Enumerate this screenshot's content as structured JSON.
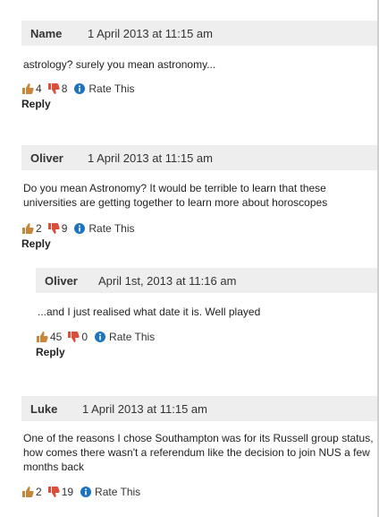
{
  "comments": [
    {
      "author": "Name",
      "date": "1 April 2013 at 11:15 am",
      "text": "astrology? surely you mean astronomy...",
      "likes": "4",
      "dislikes": "8",
      "rate_label": "Rate This",
      "reply_label": "Reply"
    },
    {
      "author": "Oliver",
      "date": "1 April 2013 at 11:15 am",
      "text": "Do you mean Astronomy? It would be terrible to learn that these universities are getting together to learn more about horoscopes",
      "likes": "2",
      "dislikes": "9",
      "rate_label": "Rate This",
      "reply_label": "Reply"
    },
    {
      "author": "Oliver",
      "date": "April 1st, 2013 at 11:16 am",
      "text": "...and I just realised what date it is. Well played",
      "likes": "45",
      "dislikes": "0",
      "rate_label": "Rate This",
      "reply_label": "Reply"
    },
    {
      "author": "Luke",
      "date": "1 April 2013 at 11:15 am",
      "text": "One of the reasons I chose Southampton was for its Russell group status, how comes there wasn't a referendum like the decision to join NUS a few months back",
      "likes": "2",
      "dislikes": "19",
      "rate_label": "Rate This"
    }
  ],
  "icons": {
    "like": "thumbs-up-icon",
    "dislike": "thumbs-down-icon",
    "info": "info-icon"
  },
  "colors": {
    "thumb_up": "#c9863a",
    "thumb_down": "#d9503a",
    "info": "#1e73be",
    "header_bg": "#eeeeee"
  }
}
